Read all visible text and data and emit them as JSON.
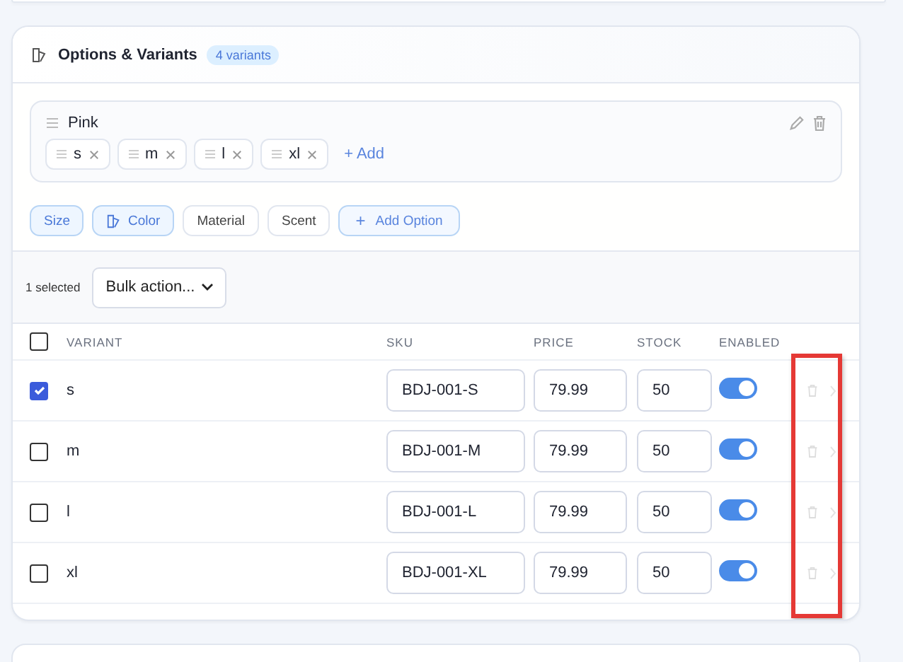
{
  "section": {
    "title": "Options & Variants",
    "badge": "4 variants"
  },
  "option": {
    "name": "Pink",
    "values": [
      {
        "label": "s"
      },
      {
        "label": "m"
      },
      {
        "label": "l"
      },
      {
        "label": "xl"
      }
    ],
    "add_label": "+ Add"
  },
  "option_types": [
    {
      "label": "Size",
      "selected": true,
      "icon": false
    },
    {
      "label": "Color",
      "selected": true,
      "icon": true
    },
    {
      "label": "Material",
      "selected": false,
      "icon": false
    },
    {
      "label": "Scent",
      "selected": false,
      "icon": false
    }
  ],
  "add_option": {
    "icon": "+",
    "label": "Add Option"
  },
  "bulk": {
    "count": "1 selected",
    "action": "Bulk action..."
  },
  "table": {
    "all_checked": false,
    "columns": [
      "VARIANT",
      "SKU",
      "PRICE",
      "STOCK",
      "ENABLED"
    ],
    "rows": [
      {
        "variant": "s",
        "sku": "BDJ-001-S",
        "price": "79.99",
        "stock": "50",
        "checked": true,
        "enabled": true
      },
      {
        "variant": "m",
        "sku": "BDJ-001-M",
        "price": "79.99",
        "stock": "50",
        "checked": false,
        "enabled": true
      },
      {
        "variant": "l",
        "sku": "BDJ-001-L",
        "price": "79.99",
        "stock": "50",
        "checked": false,
        "enabled": true
      },
      {
        "variant": "xl",
        "sku": "BDJ-001-XL",
        "price": "79.99",
        "stock": "50",
        "checked": false,
        "enabled": true
      }
    ]
  }
}
